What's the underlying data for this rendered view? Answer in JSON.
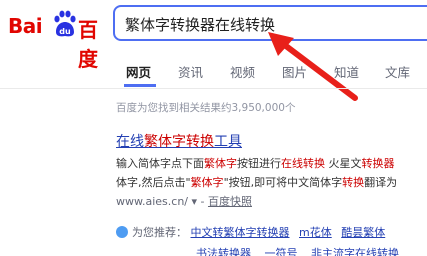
{
  "logo": {
    "part1": "Bai",
    "part2": "百度"
  },
  "search": {
    "value": "繁体字转换器在线转换"
  },
  "tabs": [
    {
      "label": "网页"
    },
    {
      "label": "资讯"
    },
    {
      "label": "视频"
    },
    {
      "label": "图片"
    },
    {
      "label": "知道"
    },
    {
      "label": "文库"
    }
  ],
  "result_count": "百度为您找到相关结果约3,950,000个",
  "result": {
    "title_prefix": "在线",
    "title_em": "繁体字转换",
    "title_suffix": "工具",
    "line1_a": "输入简体字点下面",
    "line1_b": "繁体字",
    "line1_c": "按钮进行",
    "line1_d": "在线转换",
    "line1_e": " 火星文",
    "line1_f": "转换器",
    "line2_a": "体字,然后点击\"",
    "line2_b": "繁体字",
    "line2_c": "\"按钮,即可将中文简体字",
    "line2_d": "转换",
    "line2_e": "翻译为",
    "url": "www.aies.cn/",
    "url_sep": " ▾ - ",
    "snapshot": "百度快照"
  },
  "recommend": {
    "label": "为您推荐：",
    "links1": [
      "中文转繁体字转换器",
      "m花体",
      "酷昙繁体"
    ],
    "links2": [
      "书法转换器",
      "一符号",
      "非主流字在线转换"
    ]
  },
  "colors": {
    "accent": "#4e6ef2",
    "brand": "#e10601",
    "link": "#2440b3",
    "highlight": "#cc0000"
  }
}
